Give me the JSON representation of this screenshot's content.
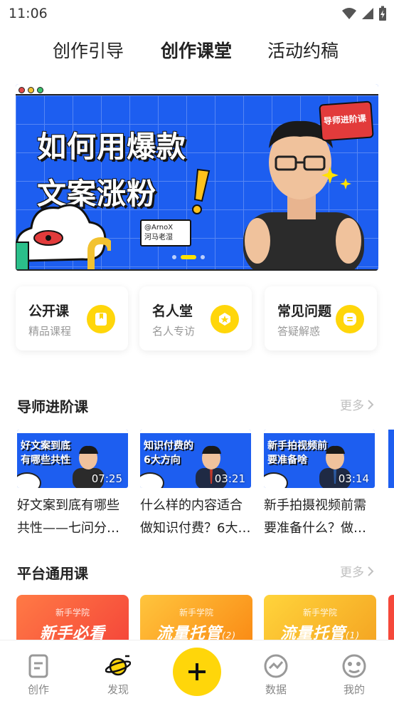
{
  "status_bar": {
    "time": "11:06"
  },
  "top_tabs": [
    {
      "label": "创作引导",
      "active": false
    },
    {
      "label": "创作课堂",
      "active": true
    },
    {
      "label": "活动约稿",
      "active": false
    }
  ],
  "banner": {
    "title_line1": "如何用爆款",
    "title_line2": "文案涨粉",
    "badge_text": "导师进阶课",
    "card_line1": "@ArnoX",
    "card_line2": "河马老湿"
  },
  "quick_entries": [
    {
      "title": "公开课",
      "subtitle": "精品课程",
      "icon": "bookmark-icon"
    },
    {
      "title": "名人堂",
      "subtitle": "名人专访",
      "icon": "star-badge-icon"
    },
    {
      "title": "常见问题",
      "subtitle": "答疑解惑",
      "icon": "faq-icon"
    }
  ],
  "sections": {
    "advanced": {
      "title": "导师进阶课",
      "more": "更多"
    },
    "general": {
      "title": "平台通用课",
      "more": "更多"
    }
  },
  "advanced_courses": [
    {
      "thumb_line1": "好文案到底",
      "thumb_line2": "有哪些共性",
      "duration": "07:25",
      "caption_line1": "好文案到底有哪些",
      "caption_line2": "共性——七问分析法"
    },
    {
      "thumb_line1": "知识付费的",
      "thumb_line2": "6大方向",
      "duration": "03:21",
      "caption_line1": "什么样的内容适合",
      "caption_line2": "做知识付费？6大…"
    },
    {
      "thumb_line1": "新手拍视频前",
      "thumb_line2": "要准备啥",
      "duration": "03:14",
      "caption_line1": "新手拍摄视频前需",
      "caption_line2": "要准备什么？做…"
    }
  ],
  "general_courses": [
    {
      "small": "新手学院",
      "big": "新手必看",
      "suffix": "",
      "color_from": "#ff7a45",
      "color_to": "#f5483a"
    },
    {
      "small": "新手学院",
      "big": "流量托管",
      "suffix": "(2)",
      "color_from": "#ffc53d",
      "color_to": "#fa8c16"
    },
    {
      "small": "新手学院",
      "big": "流量托管",
      "suffix": "(1)",
      "color_from": "#ffd43b",
      "color_to": "#f5a623"
    }
  ],
  "bottom_nav": [
    {
      "label": "创作",
      "icon": "document-icon"
    },
    {
      "label": "发现",
      "icon": "planet-icon",
      "active": true
    },
    {
      "label": "数据",
      "icon": "chart-icon"
    },
    {
      "label": "我的",
      "icon": "profile-icon"
    }
  ],
  "colors": {
    "accent": "#ffd60a",
    "banner_blue": "#1d5ef0"
  }
}
